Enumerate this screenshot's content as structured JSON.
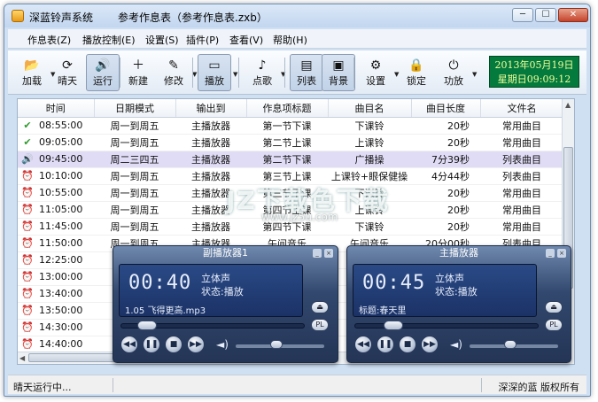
{
  "window": {
    "app_title": "深蓝铃声系统",
    "doc_title": "参考作息表（参考作息表.zxb）",
    "min_label": "─",
    "max_label": "☐",
    "close_label": "✕"
  },
  "menu": [
    "作息表(Z)",
    "播放控制(E)",
    "设置(S)",
    "插件(P)",
    "查看(V)",
    "帮助(H)"
  ],
  "toolbar": {
    "buttons": [
      {
        "label": "加载",
        "icon": "folder-open-icon",
        "glyph": "📂",
        "pressed": false,
        "arrow": true
      },
      {
        "label": "晴天",
        "icon": "sun-refresh-icon",
        "glyph": "⟳",
        "pressed": false,
        "arrow": false
      },
      {
        "label": "运行",
        "icon": "speaker-icon",
        "glyph": "🔊",
        "pressed": true,
        "arrow": false
      },
      {
        "label": "新建",
        "icon": "new-doc-icon",
        "glyph": "＋",
        "pressed": false,
        "arrow": false
      },
      {
        "label": "修改",
        "icon": "edit-icon",
        "glyph": "✎",
        "pressed": false,
        "arrow": true
      },
      {
        "label": "播放",
        "icon": "player-icon",
        "glyph": "▭",
        "pressed": true,
        "arrow": true
      },
      {
        "label": "点歌",
        "icon": "music-note-icon",
        "glyph": "♪",
        "pressed": false,
        "arrow": true
      },
      {
        "label": "列表",
        "icon": "list-icon",
        "glyph": "▤",
        "pressed": true,
        "arrow": false
      },
      {
        "label": "背景",
        "icon": "image-icon",
        "glyph": "▣",
        "pressed": true,
        "arrow": false
      },
      {
        "label": "设置",
        "icon": "gear-icon",
        "glyph": "⚙",
        "pressed": false,
        "arrow": true
      },
      {
        "label": "锁定",
        "icon": "lock-icon",
        "glyph": "🔒",
        "pressed": false,
        "arrow": false
      },
      {
        "label": "功放",
        "icon": "power-icon",
        "glyph": "⏻",
        "pressed": false,
        "arrow": true
      }
    ],
    "clock_date": "2013年05月19日",
    "clock_time": "星期日09:09:12"
  },
  "table": {
    "columns": [
      "时间",
      "日期模式",
      "输出到",
      "作息项标题",
      "曲目名",
      "曲目长度",
      "文件名"
    ],
    "rows": [
      {
        "status": "done",
        "time": "08:55:00",
        "mode": "周一到周五",
        "out": "主播放器",
        "title": "第一节下课",
        "track": "下课铃",
        "len": "20秒",
        "file": "常用曲目"
      },
      {
        "status": "done",
        "time": "09:05:00",
        "mode": "周一到周五",
        "out": "主播放器",
        "title": "第二节上课",
        "track": "上课铃",
        "len": "20秒",
        "file": "常用曲目"
      },
      {
        "status": "play",
        "time": "09:45:00",
        "mode": "周二三四五",
        "out": "主播放器",
        "title": "第二节下课",
        "track": "广播操",
        "len": "7分39秒",
        "file": "列表曲目"
      },
      {
        "status": "wait",
        "time": "10:10:00",
        "mode": "周一到周五",
        "out": "主播放器",
        "title": "第三节上课",
        "track": "上课铃+眼保健操",
        "len": "4分44秒",
        "file": "列表曲目"
      },
      {
        "status": "wait",
        "time": "10:55:00",
        "mode": "周一到周五",
        "out": "主播放器",
        "title": "第三节下课",
        "track": "下课铃",
        "len": "20秒",
        "file": "常用曲目"
      },
      {
        "status": "wait",
        "time": "11:05:00",
        "mode": "周一到周五",
        "out": "主播放器",
        "title": "第四节上课",
        "track": "上课铃",
        "len": "20秒",
        "file": "常用曲目"
      },
      {
        "status": "wait",
        "time": "11:45:00",
        "mode": "周一到周五",
        "out": "主播放器",
        "title": "第四节下课",
        "track": "下课铃",
        "len": "20秒",
        "file": "常用曲目"
      },
      {
        "status": "wait",
        "time": "11:50:00",
        "mode": "周一到周五",
        "out": "主播放器",
        "title": "午间音乐",
        "track": "午间音乐",
        "len": "20分00秒",
        "file": "列表曲目"
      },
      {
        "status": "wait",
        "time": "12:25:00",
        "mode": "周",
        "out": "",
        "title": "",
        "track": "",
        "len": "",
        "file": ""
      },
      {
        "status": "wait",
        "time": "13:00:00",
        "mode": "周",
        "out": "",
        "title": "",
        "track": "",
        "len": "",
        "file": ""
      },
      {
        "status": "wait",
        "time": "13:40:00",
        "mode": "周",
        "out": "",
        "title": "",
        "track": "",
        "len": "",
        "file": ""
      },
      {
        "status": "wait",
        "time": "13:50:00",
        "mode": "周",
        "out": "",
        "title": "",
        "track": "",
        "len": "",
        "file": ""
      },
      {
        "status": "wait",
        "time": "14:30:00",
        "mode": "周",
        "out": "",
        "title": "",
        "track": "",
        "len": "",
        "file": ""
      },
      {
        "status": "wait",
        "time": "14:40:00",
        "mode": "周",
        "out": "",
        "title": "",
        "track": "课",
        "len": "",
        "file": ""
      },
      {
        "status": "wait",
        "time": "15:25:00",
        "mode": "周",
        "out": "",
        "title": "",
        "track": "",
        "len": "",
        "file": ""
      }
    ],
    "active_row": 2
  },
  "watermark": {
    "main": "JZ下载色下载",
    "sub": "www.jz5u.com"
  },
  "sub_player": {
    "title": "副播放器1",
    "time": "00:40",
    "channel": "立体声",
    "status": "状态:播放",
    "track": "1.05 飞得更高.mp3",
    "progress": 0.1,
    "volume": 0.45
  },
  "main_player": {
    "title": "主播放器",
    "time": "00:45",
    "channel": "立体声",
    "status": "状态:播放",
    "track": "标题:春天里",
    "progress": 0.18,
    "volume": 0.45
  },
  "player_controls": {
    "prev": "◀◀",
    "pause": "❚❚",
    "stop": "■",
    "next": "▶▶",
    "eject": "⏏",
    "pl": "PL"
  },
  "status": {
    "left": "晴天运行中...",
    "right": "深深的蓝 版权所有"
  }
}
